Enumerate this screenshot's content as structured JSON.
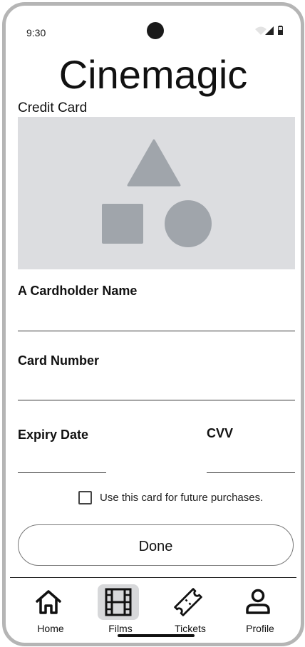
{
  "status_bar": {
    "time": "9:30"
  },
  "app": {
    "title": "Cinemagic"
  },
  "payment": {
    "section_label": "Credit Card",
    "fields": {
      "cardholder_label": "A Cardholder Name",
      "card_number_label": "Card Number",
      "expiry_label": "Expiry Date",
      "cvv_label": "CVV"
    },
    "save_card_label": "Use this card for future purchases.",
    "save_card_checked": false,
    "done_label": "Done"
  },
  "nav": {
    "items": [
      {
        "label": "Home",
        "icon": "home-icon",
        "active": false
      },
      {
        "label": "Films",
        "icon": "film-icon",
        "active": true
      },
      {
        "label": "Tickets",
        "icon": "ticket-icon",
        "active": false
      },
      {
        "label": "Profile",
        "icon": "profile-icon",
        "active": false
      }
    ]
  },
  "colors": {
    "placeholder_bg": "#dcdde0",
    "placeholder_shapes": "#a0a5ab",
    "active_nav_bg": "#d7d8da"
  }
}
